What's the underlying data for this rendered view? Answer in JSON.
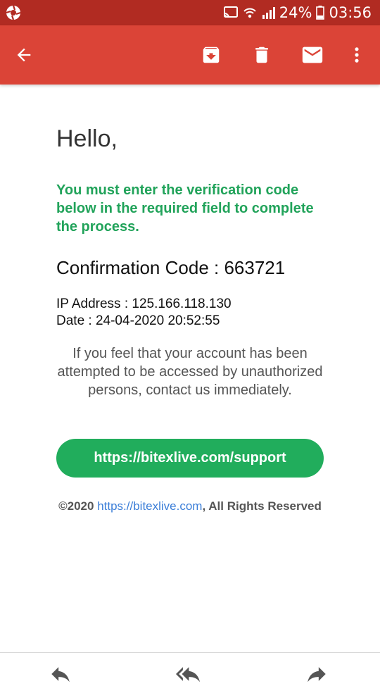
{
  "status_bar": {
    "battery": "24%",
    "time": "03:56",
    "icons": [
      "app-notification-icon",
      "cast-icon",
      "wifi-icon",
      "signal-icon",
      "battery-icon"
    ]
  },
  "toolbar": {
    "back_icon": "arrow-left-icon",
    "actions": [
      "archive-icon",
      "delete-icon",
      "mark-unread-icon",
      "more-vert-icon"
    ],
    "background": "#db4437"
  },
  "email": {
    "greeting": "Hello,",
    "notice": "You must enter the verification code below in the required field to complete the process.",
    "confirmation_label": "Confirmation Code : 663721",
    "ip_line": "IP Address : 125.166.118.130",
    "date_line": "Date : 24-04-2020 20:52:55",
    "warning": "If you feel that your account has been attempted to be accessed by unauthorized persons, contact us immediately.",
    "support_button": "https://bitexlive.com/support",
    "footer_prefix": "©2020 ",
    "footer_link": "https://bitexlive.com",
    "footer_suffix": ", All Rights Reserved"
  },
  "bottom_actions": [
    "reply-icon",
    "reply-all-icon",
    "forward-icon"
  ],
  "colors": {
    "accent_green": "#21ad5c",
    "link_blue": "#3b7ed8",
    "status_bar": "#b12b22"
  }
}
